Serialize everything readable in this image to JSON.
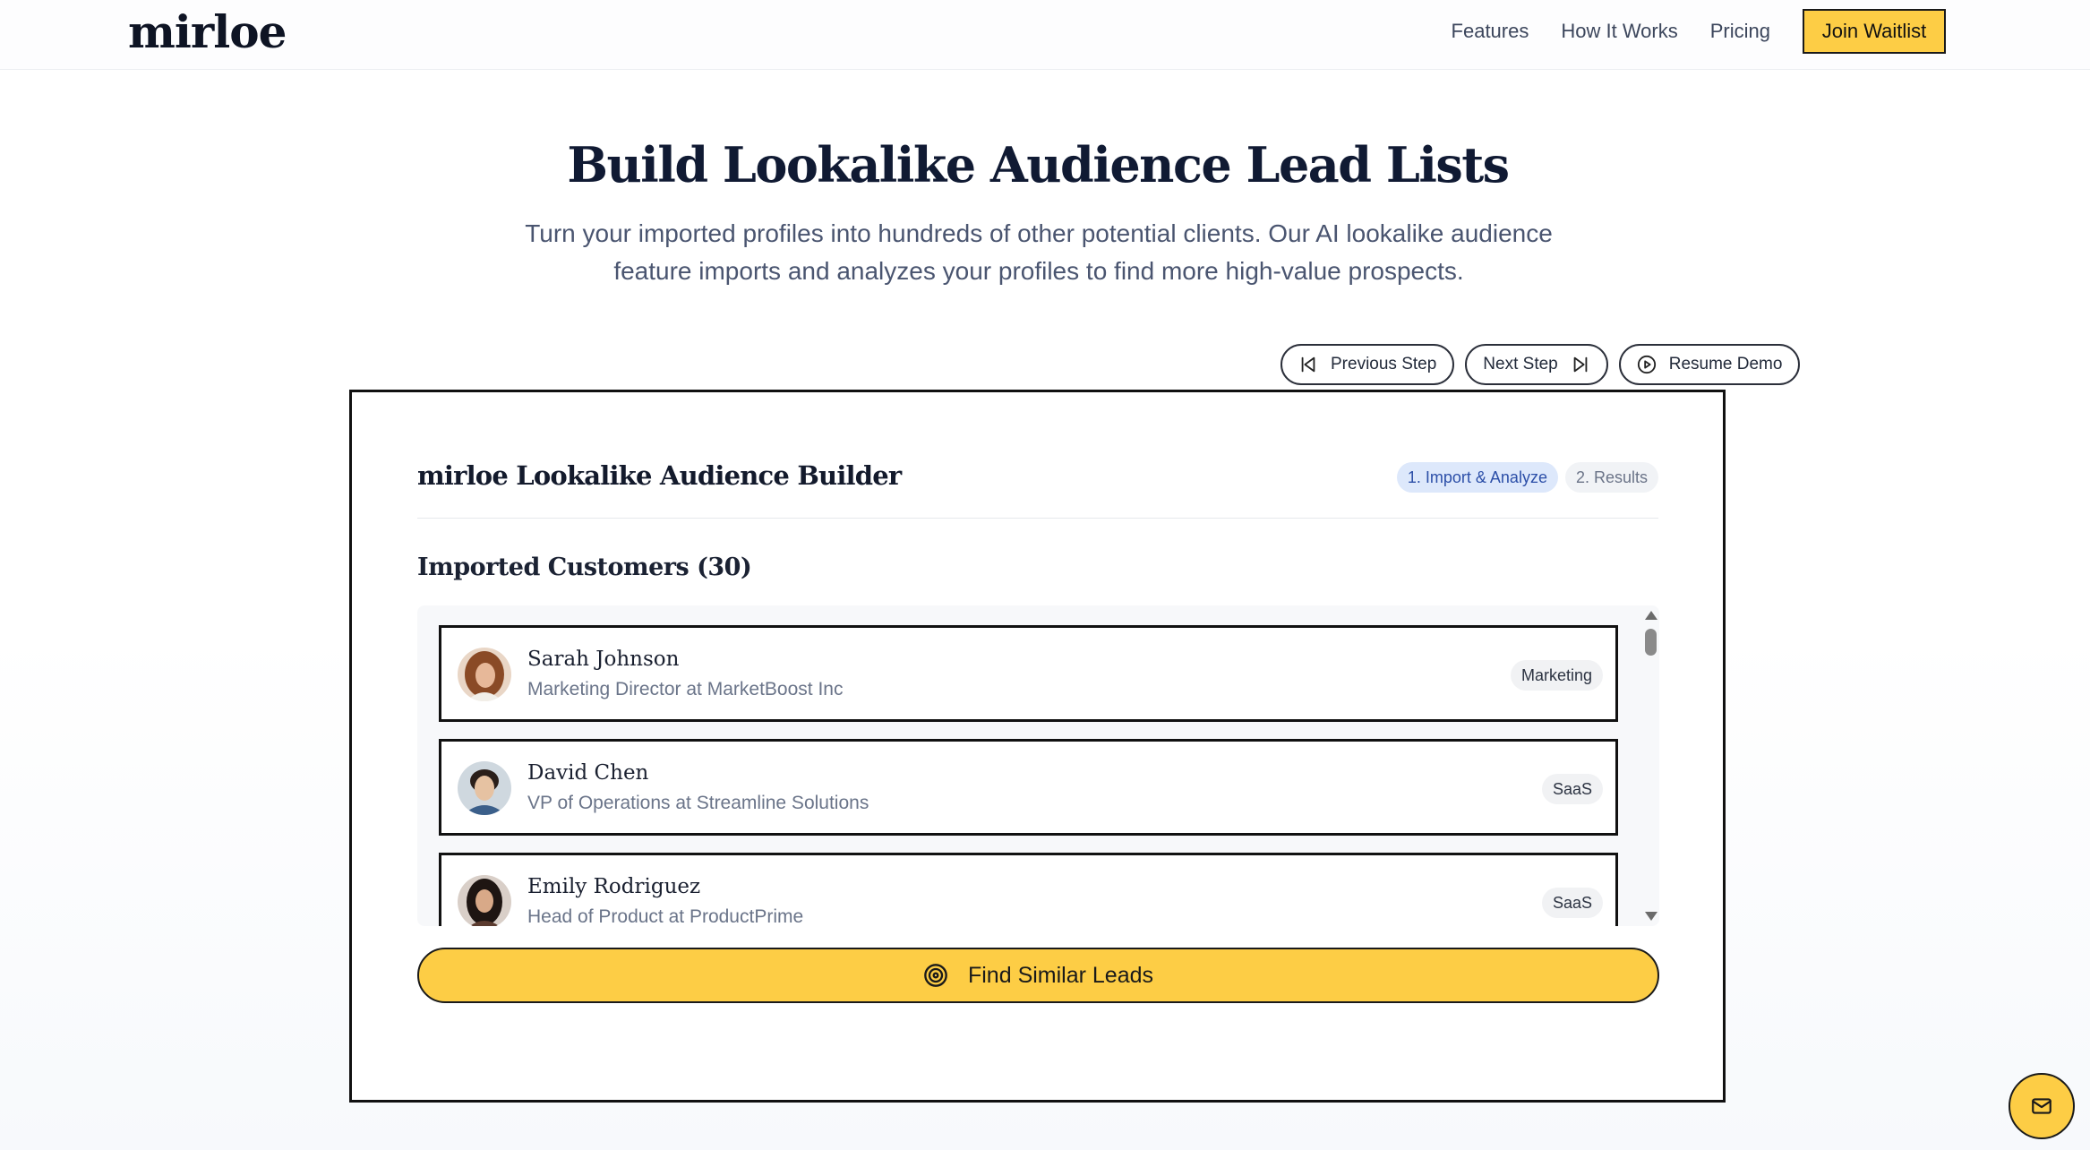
{
  "brand": {
    "logo": "mirloe",
    "accent": "#fdcd45"
  },
  "nav": {
    "links": [
      "Features",
      "How It Works",
      "Pricing"
    ],
    "cta": "Join Waitlist"
  },
  "hero": {
    "title": "Build Lookalike Audience Lead Lists",
    "subtitle": "Turn your imported profiles into hundreds of other potential clients. Our AI lookalike audience feature imports and analyzes your profiles to find more high-value prospects."
  },
  "demo_controls": {
    "previous": "Previous Step",
    "next": "Next Step",
    "resume": "Resume Demo"
  },
  "panel": {
    "title": "mirloe Lookalike Audience Builder",
    "steps": [
      {
        "label": "1. Import & Analyze",
        "active": true
      },
      {
        "label": "2. Results",
        "active": false
      }
    ],
    "section_title": "Imported Customers (30)",
    "customers": [
      {
        "name": "Sarah Johnson",
        "role": "Marketing Director at MarketBoost Inc",
        "tag": "Marketing"
      },
      {
        "name": "David Chen",
        "role": "VP of Operations at Streamline Solutions",
        "tag": "SaaS"
      },
      {
        "name": "Emily Rodriguez",
        "role": "Head of Product at ProductPrime",
        "tag": "SaaS"
      }
    ],
    "find_button": "Find Similar Leads"
  },
  "icons": {
    "previous": "skip-back-icon",
    "next": "skip-forward-icon",
    "resume": "play-circle-icon",
    "find": "target-icon",
    "fab": "mail-icon"
  }
}
